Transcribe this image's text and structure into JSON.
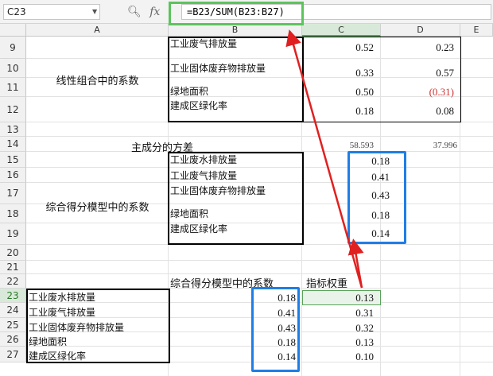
{
  "formula_bar": {
    "name_box": "C23",
    "icons": [
      "zoom-icon",
      "fx-icon"
    ],
    "fx_label": "fx",
    "formula": "=B23/SUM(B23:B27)"
  },
  "columns": [
    "A",
    "B",
    "C",
    "D",
    "E"
  ],
  "rows": [
    "9",
    "10",
    "11",
    "12",
    "13",
    "14",
    "15",
    "16",
    "17",
    "18",
    "19",
    "20",
    "21",
    "22",
    "23",
    "24",
    "25",
    "26",
    "27"
  ],
  "section1": {
    "title": "线性组合中的系数",
    "labels": [
      "工业废气排放量",
      "工业固体废弃物排放量",
      "绿地面积",
      "建成区绿化率"
    ],
    "c_values": [
      "0.52",
      "0.33",
      "0.50",
      "0.18"
    ],
    "d_values": [
      "0.23",
      "0.57",
      "(0.31)",
      "0.08"
    ]
  },
  "row14": {
    "label": "主成分的方差",
    "c": "58.593",
    "d": "37.996"
  },
  "section2": {
    "title": "综合得分模型中的系数",
    "labels": [
      "工业废水排放量",
      "工业废气排放量",
      "工业固体废弃物排放量",
      "绿地面积",
      "建成区绿化率"
    ],
    "values": [
      "0.18",
      "0.41",
      "0.43",
      "0.18",
      "0.14"
    ]
  },
  "row22": {
    "b": "综合得分模型中的系数",
    "c": "指标权重"
  },
  "section3": {
    "labels": [
      "工业废水排放量",
      "工业废气排放量",
      "工业固体废弃物排放量",
      "绿地面积",
      "建成区绿化率"
    ],
    "b_values": [
      "0.18",
      "0.41",
      "0.43",
      "0.18",
      "0.14"
    ],
    "c_values": [
      "0.13",
      "0.31",
      "0.32",
      "0.13",
      "0.10"
    ]
  },
  "colors": {
    "annotation_red": "#e02020",
    "annotation_blue": "#1e7ee6",
    "annotation_green": "#5cc45c",
    "negative_red": "#d03030",
    "selection_green": "#5aa25a"
  }
}
